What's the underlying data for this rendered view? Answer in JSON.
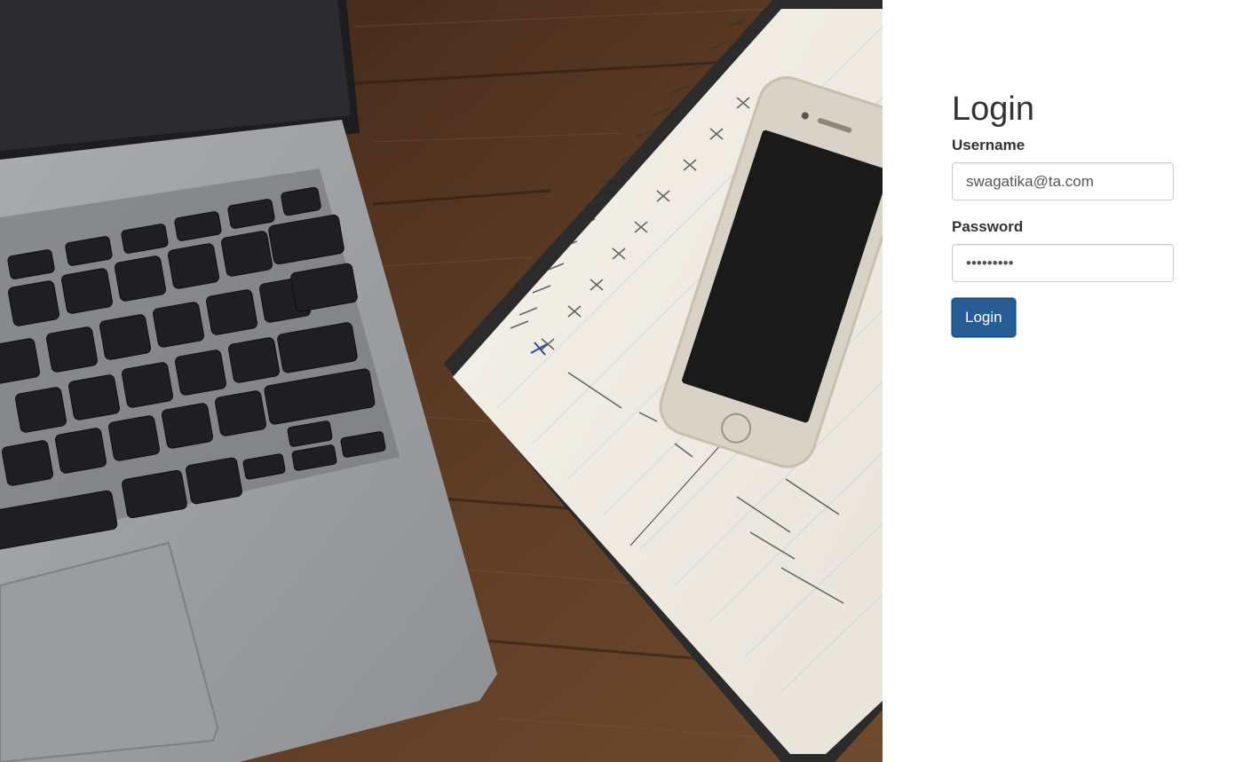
{
  "login_form": {
    "title": "Login",
    "username_label": "Username",
    "username_value": "swagatika@ta.com",
    "password_label": "Password",
    "password_value": "123456789",
    "submit_label": "Login"
  },
  "colors": {
    "button_bg": "#275d94",
    "text": "#333333",
    "input_border": "#cccccc"
  },
  "hero_image": {
    "icon": "desk-photo-image"
  }
}
